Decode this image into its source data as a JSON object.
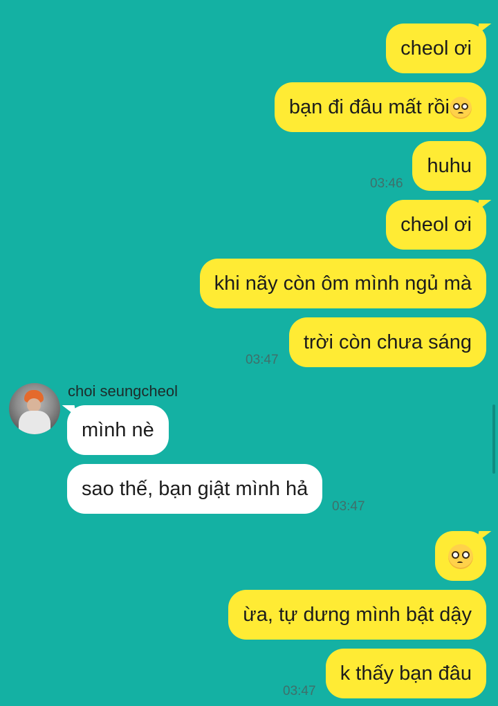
{
  "chat": {
    "sender_name": "choi seungcheol",
    "messages_out_1": [
      "cheol ơi",
      "bạn đi đâu mất rồi",
      "huhu"
    ],
    "time_1": "03:46",
    "messages_out_2": [
      "cheol ơi",
      "khi nãy còn ôm mình ngủ mà",
      "trời còn chưa sáng"
    ],
    "time_2": "03:47",
    "messages_in": [
      "mình nè",
      "sao thế, bạn giật mình hả"
    ],
    "time_3": "03:47",
    "messages_out_3": [
      "",
      "ừa, tự dưng mình bật dậy",
      "k thấy bạn đâu"
    ],
    "time_4": "03:47",
    "emoji_name": "pleading-face-icon"
  },
  "colors": {
    "background": "#14b1a3",
    "outgoing_bubble": "#ffeb34",
    "incoming_bubble": "#ffffff"
  }
}
